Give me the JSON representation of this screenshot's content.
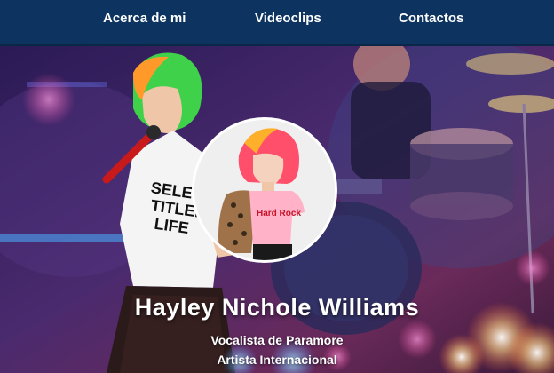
{
  "nav": {
    "items": [
      {
        "label": "Acerca de mi"
      },
      {
        "label": "Videoclips"
      },
      {
        "label": "Contactos"
      }
    ]
  },
  "hero": {
    "name": "Hayley Nichole Williams",
    "subtitle_line1": "Vocalista de Paramore",
    "subtitle_line2": "Artista Internacional",
    "profile_photo": "hayley-portrait",
    "background_photo": "concert-stage"
  },
  "colors": {
    "navbar": "#0d3460",
    "text": "#ffffff",
    "hair_green": "#3fd14a",
    "hair_pink": "#ff4fa0"
  }
}
